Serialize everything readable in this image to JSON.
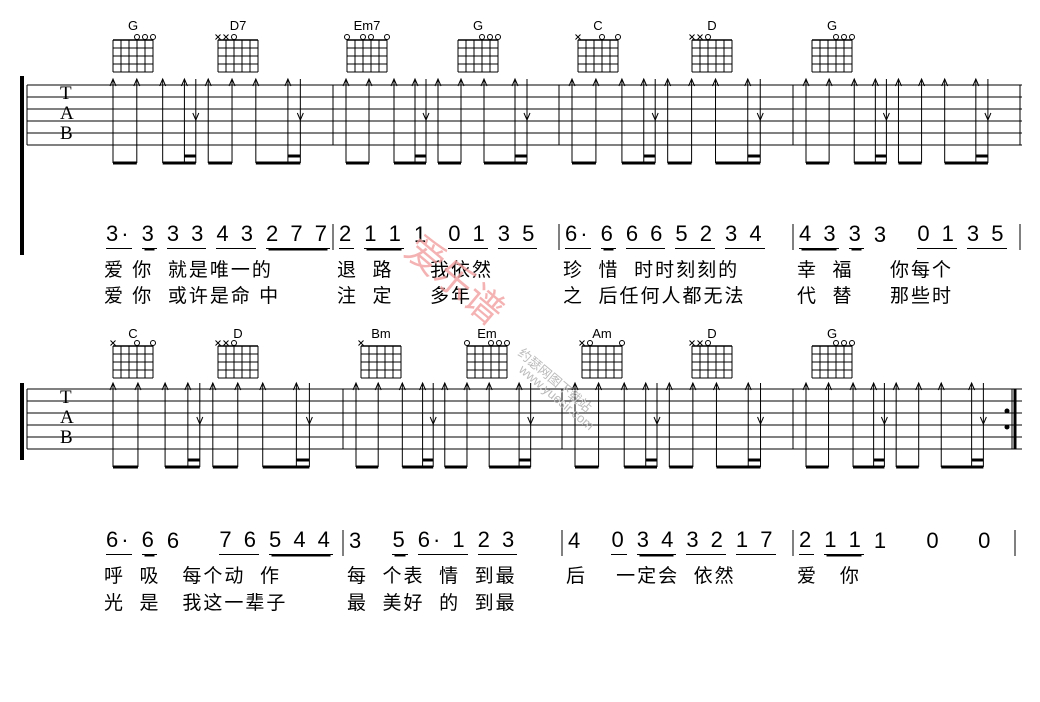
{
  "rows": [
    {
      "chords": [
        {
          "name": "G",
          "marks": "   ooo"
        },
        {
          "name": "D7",
          "marks": "xxo   "
        },
        {
          "name": "Em7",
          "marks": "o oo o"
        },
        {
          "name": "G",
          "marks": "   ooo"
        },
        {
          "name": "C",
          "marks": "x  o o"
        },
        {
          "name": "D",
          "marks": "xxo   "
        },
        {
          "name": "G",
          "marks": "   ooo"
        }
      ],
      "measures": [
        {
          "notes": [
            {
              "t": "3·",
              "u": 1
            },
            {
              "t": "3",
              "u": 2
            },
            {
              "t": "3 3",
              "u": 1
            },
            {
              "t": "4 3",
              "u": 1
            },
            {
              "t": "2 7 7",
              "u": 2
            }
          ],
          "lyric1": "爱 你  就是唯一的",
          "lyric2": "爱 你  或许是命 中"
        },
        {
          "notes": [
            {
              "t": "2",
              "u": 1
            },
            {
              "t": "1 1",
              "u": 2
            },
            {
              "t": "1 ",
              "u": 0
            },
            {
              "t": "0 1",
              "u": 1
            },
            {
              "t": "3 5",
              "u": 1
            }
          ],
          "lyric1": "退  路     我依然",
          "lyric2": "注  定     多年"
        },
        {
          "notes": [
            {
              "t": "6·",
              "u": 1
            },
            {
              "t": "6",
              "u": 2
            },
            {
              "t": "6 6",
              "u": 1
            },
            {
              "t": "5 2",
              "u": 1
            },
            {
              "t": "3 4",
              "u": 1
            }
          ],
          "lyric1": "珍  惜  时时刻刻的",
          "lyric2": "之  后任何人都无法"
        },
        {
          "notes": [
            {
              "t": "4 3",
              "u": 2
            },
            {
              "t": "3",
              "u": 2
            },
            {
              "t": "3  ",
              "u": 0
            },
            {
              "t": "0 1",
              "u": 1
            },
            {
              "t": "3 5",
              "u": 1
            }
          ],
          "lyric1": "幸  福     你每个",
          "lyric2": "代  替     那些时"
        }
      ]
    },
    {
      "chords": [
        {
          "name": "C",
          "marks": "x  o o"
        },
        {
          "name": "D",
          "marks": "xxo   "
        },
        {
          "name": "Bm",
          "marks": "x     "
        },
        {
          "name": "Em",
          "marks": "o  ooo"
        },
        {
          "name": "Am",
          "marks": "xo   o"
        },
        {
          "name": "D",
          "marks": "xxo   "
        },
        {
          "name": "G",
          "marks": "   ooo"
        }
      ],
      "measures": [
        {
          "notes": [
            {
              "t": "6·",
              "u": 1
            },
            {
              "t": "6",
              "u": 2
            },
            {
              "t": "6   ",
              "u": 0
            },
            {
              "t": "7 6",
              "u": 1
            },
            {
              "t": "5 4 4",
              "u": 2
            }
          ],
          "lyric1": "呼  吸   每个动  作",
          "lyric2": "光  是   我这一辈子"
        },
        {
          "notes": [
            {
              "t": "3  ",
              "u": 0
            },
            {
              "t": "5",
              "u": 2
            },
            {
              "t": "6· 1",
              "u": 1
            },
            {
              "t": "2 3",
              "u": 1
            }
          ],
          "lyric1": "每  个表  情  到最",
          "lyric2": "最  美好  的  到最"
        },
        {
          "notes": [
            {
              "t": "4  ",
              "u": 0
            },
            {
              "t": "0",
              "u": 1
            },
            {
              "t": "3 4",
              "u": 2
            },
            {
              "t": "3 2",
              "u": 1
            },
            {
              "t": "1 7",
              "u": 1
            }
          ],
          "lyric1": "后    一定会  依然",
          "lyric2": ""
        },
        {
          "notes": [
            {
              "t": "2",
              "u": 1
            },
            {
              "t": "1 1",
              "u": 2
            },
            {
              "t": "1   ",
              "u": 0
            },
            {
              "t": "0    0",
              "u": 0
            }
          ],
          "lyric1": "爱   你",
          "lyric2": ""
        }
      ]
    }
  ],
  "tab_letters": [
    "T",
    "A",
    "B"
  ],
  "end_repeat": ":‖",
  "watermark": {
    "main": "爱乐谱",
    "sub": "约瑟网图下载站",
    "url": "www.yuesir.com"
  }
}
